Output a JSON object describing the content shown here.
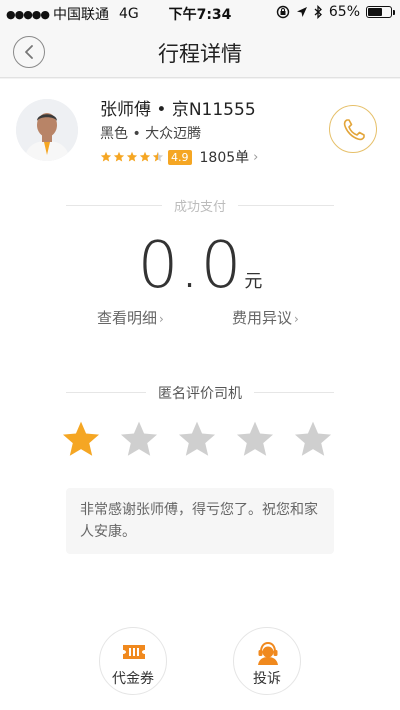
{
  "status_bar": {
    "carrier": "中国联通",
    "network": "4G",
    "time": "下午7:34",
    "battery": "65%",
    "battery_level": 0.65,
    "signal_dots": "●●●●●"
  },
  "nav": {
    "title": "行程详情",
    "back_icon": "chevron-left-icon"
  },
  "driver": {
    "name": "张师傅 • 京N11555",
    "car": "黑色 • 大众迈腾",
    "rating": "4.9",
    "rating_stars": 4.5,
    "orders": "1805单",
    "orders_arrow": "›"
  },
  "payment": {
    "status": "成功支付",
    "amount": "0.0",
    "currency": "元",
    "detail_link": "查看明细",
    "dispute_link": "费用异议",
    "arrow": "›"
  },
  "rating_section": {
    "title": "匿名评价司机",
    "selected_stars": 1,
    "total_stars": 5,
    "comment": "非常感谢张师傅，得亏您了。祝您和家人安康。"
  },
  "actions": {
    "coupon_label": "代金券",
    "complaint_label": "投诉"
  },
  "colors": {
    "accent": "#f5a623",
    "star_inactive": "#cfcfcf",
    "call_border": "#e6c06a",
    "coupon_icon": "#f0891e",
    "complaint_icon": "#f0891e"
  }
}
